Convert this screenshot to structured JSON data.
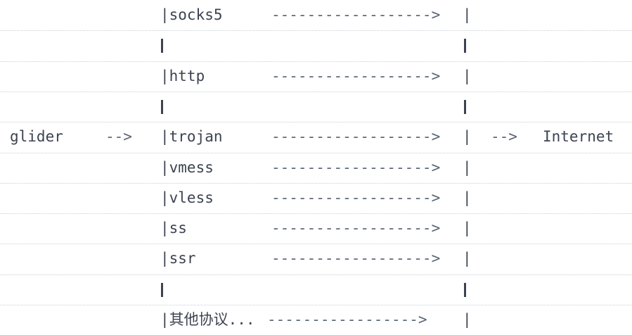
{
  "diagram": {
    "left_label": "glider",
    "left_arrow": "-->",
    "right_arrow": "-->",
    "right_label": "Internet",
    "long_arrow": "------------------>",
    "protocols": [
      {
        "label": "|socks5"
      },
      {
        "label": null
      },
      {
        "label": "|http"
      },
      {
        "label": null
      },
      {
        "label": "|trojan"
      },
      {
        "label": "|vmess"
      },
      {
        "label": "|vless"
      },
      {
        "label": "|ss"
      },
      {
        "label": "|ssr"
      },
      {
        "label": null
      },
      {
        "label": "|其他协议...",
        "arrow": "----------------->"
      }
    ],
    "row_end": "|",
    "center_row_index": 4
  }
}
